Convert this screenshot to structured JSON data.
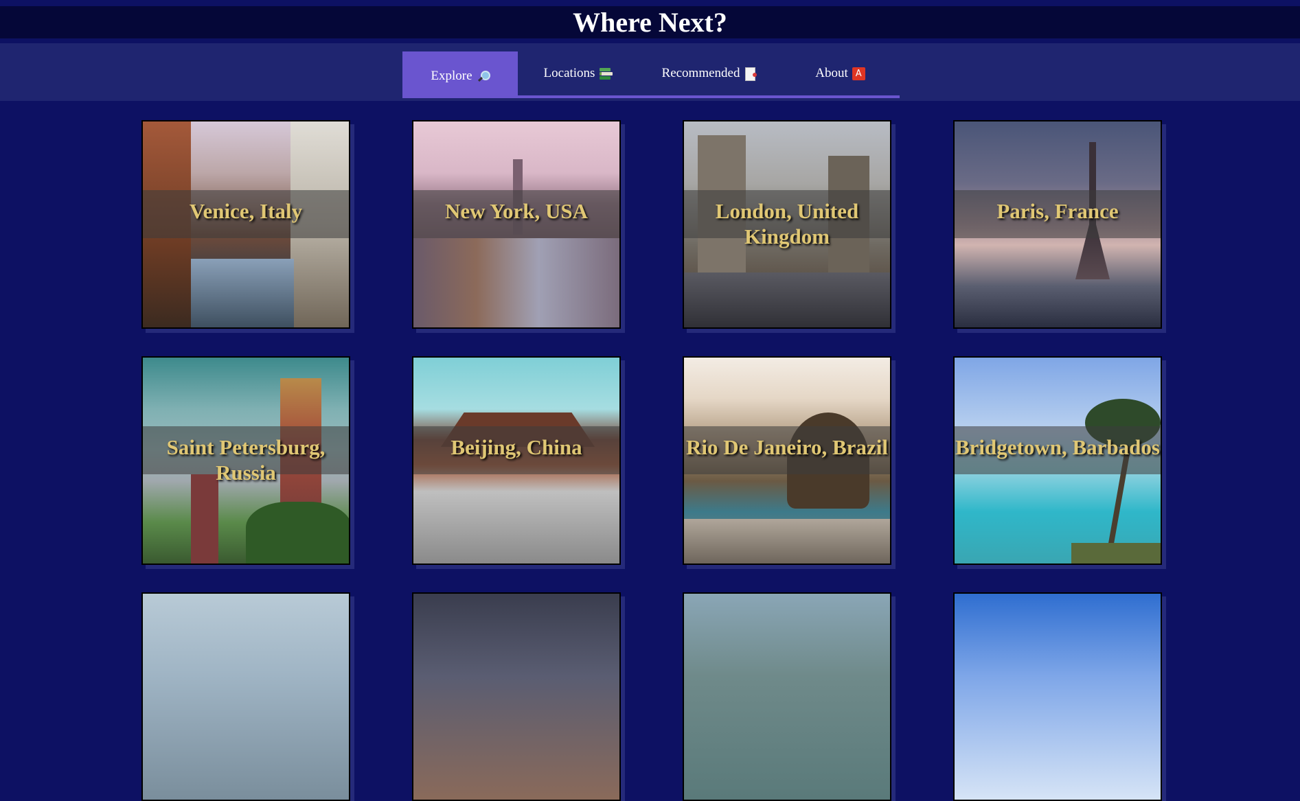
{
  "header": {
    "title": "Where Next?"
  },
  "nav": {
    "tabs": [
      {
        "label": "Explore",
        "icon": "magnifier-icon",
        "active": true
      },
      {
        "label": "Locations",
        "icon": "books-icon",
        "active": false
      },
      {
        "label": "Recommended",
        "icon": "document-icon",
        "active": false
      },
      {
        "label": "About",
        "icon": "a-badge-icon",
        "badge": "A",
        "active": false
      }
    ]
  },
  "colors": {
    "background": "#0d1163",
    "header": "#050738",
    "navbar": "#1f2570",
    "accent": "#6a55cf",
    "title_text": "#e0c774"
  },
  "destinations": [
    {
      "name": "Venice, Italy",
      "image": "venice-canal-photo"
    },
    {
      "name": "New York, USA",
      "image": "new-york-skyline-photo"
    },
    {
      "name": "London, United Kingdom",
      "image": "tower-bridge-photo"
    },
    {
      "name": "Paris, France",
      "image": "eiffel-tower-photo"
    },
    {
      "name": "Saint Petersburg, Russia",
      "image": "onion-domes-photo"
    },
    {
      "name": "Beijing, China",
      "image": "forbidden-city-photo"
    },
    {
      "name": "Rio De Janeiro, Brazil",
      "image": "sugarloaf-mountain-photo"
    },
    {
      "name": "Bridgetown, Barbados",
      "image": "palm-beach-photo"
    },
    {
      "name": "",
      "image": "coastline-photo"
    },
    {
      "name": "",
      "image": "city-night-photo"
    },
    {
      "name": "",
      "image": "harbor-aerial-photo"
    },
    {
      "name": "",
      "image": "blue-sky-cliff-photo"
    }
  ]
}
